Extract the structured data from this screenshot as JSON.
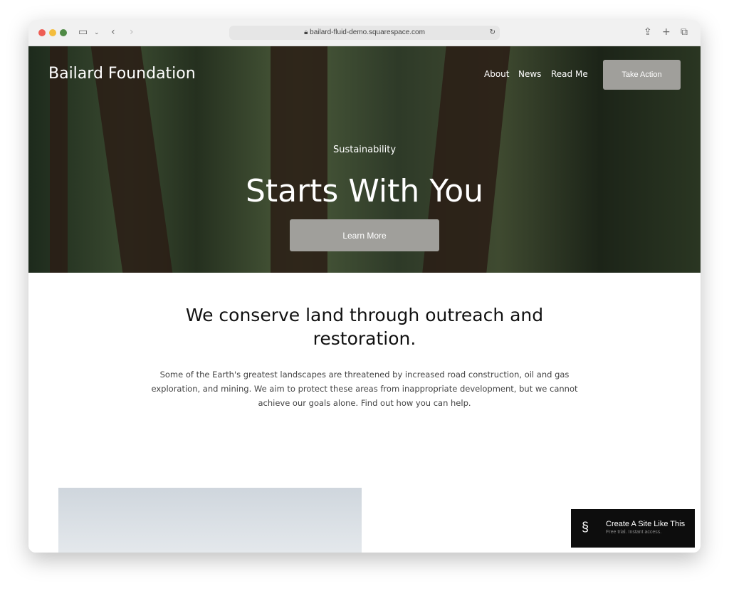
{
  "browser": {
    "url": "bailard-fluid-demo.squarespace.com"
  },
  "header": {
    "brand": "Bailard Foundation",
    "nav": [
      "About",
      "News",
      "Read Me"
    ],
    "cta": "Take Action"
  },
  "hero": {
    "kicker": "Sustainability",
    "title": "Starts With You",
    "button": "Learn More"
  },
  "intro": {
    "heading": "We conserve land through outreach and restoration.",
    "body": "Some of the Earth's greatest landscapes are threatened by increased road construction, oil and gas exploration, and mining. We aim to protect these areas from inappropriate development, but we cannot achieve our goals alone. Find out how you can help."
  },
  "badge": {
    "title": "Create A Site Like This",
    "subtitle": "Free trial. Instant access."
  }
}
